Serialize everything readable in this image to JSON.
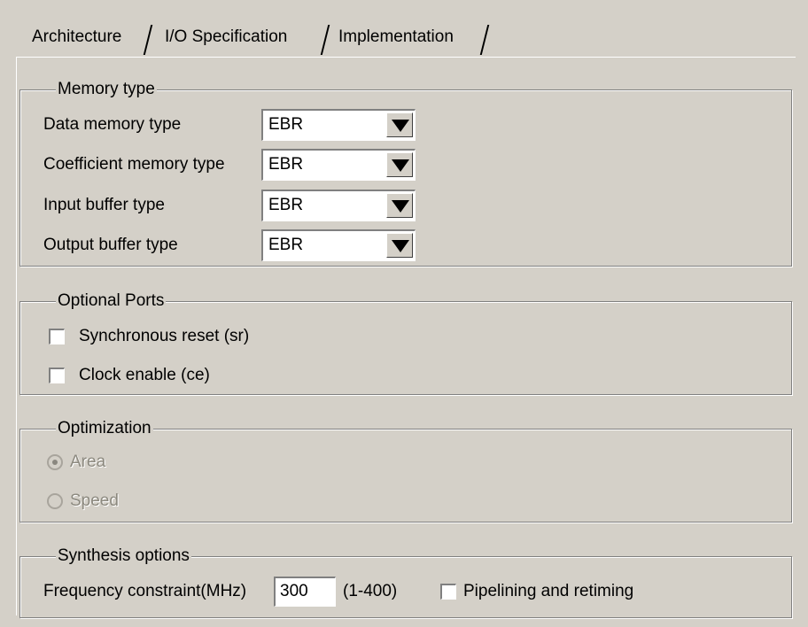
{
  "tabs": [
    {
      "label": "Architecture"
    },
    {
      "label": "I/O Specification"
    },
    {
      "label": "Implementation",
      "selected": true
    }
  ],
  "memory_type": {
    "title": "Memory type",
    "fields": [
      {
        "label": "Data memory type",
        "value": "EBR"
      },
      {
        "label": "Coefficient memory type",
        "value": "EBR"
      },
      {
        "label": "Input buffer type",
        "value": "EBR"
      },
      {
        "label": "Output buffer type",
        "value": "EBR"
      }
    ]
  },
  "optional_ports": {
    "title": "Optional Ports",
    "options": [
      {
        "label": "Synchronous reset (sr)",
        "checked": false
      },
      {
        "label": "Clock enable (ce)",
        "checked": false
      }
    ]
  },
  "optimization": {
    "title": "Optimization",
    "options": [
      {
        "label": "Area",
        "selected": true,
        "enabled": false
      },
      {
        "label": "Speed",
        "selected": false,
        "enabled": false
      }
    ]
  },
  "synthesis": {
    "title": "Synthesis options",
    "freq_label": "Frequency constraint(MHz)",
    "freq_value": "300",
    "freq_range": "(1-400)",
    "pipelining_label": "Pipelining and retiming",
    "pipelining_checked": false
  },
  "colors": {
    "window_bg": "#d4d0c8",
    "disabled_text": "#8c897f"
  },
  "icons": {
    "combo_arrow": "dropdown-arrow-icon"
  }
}
